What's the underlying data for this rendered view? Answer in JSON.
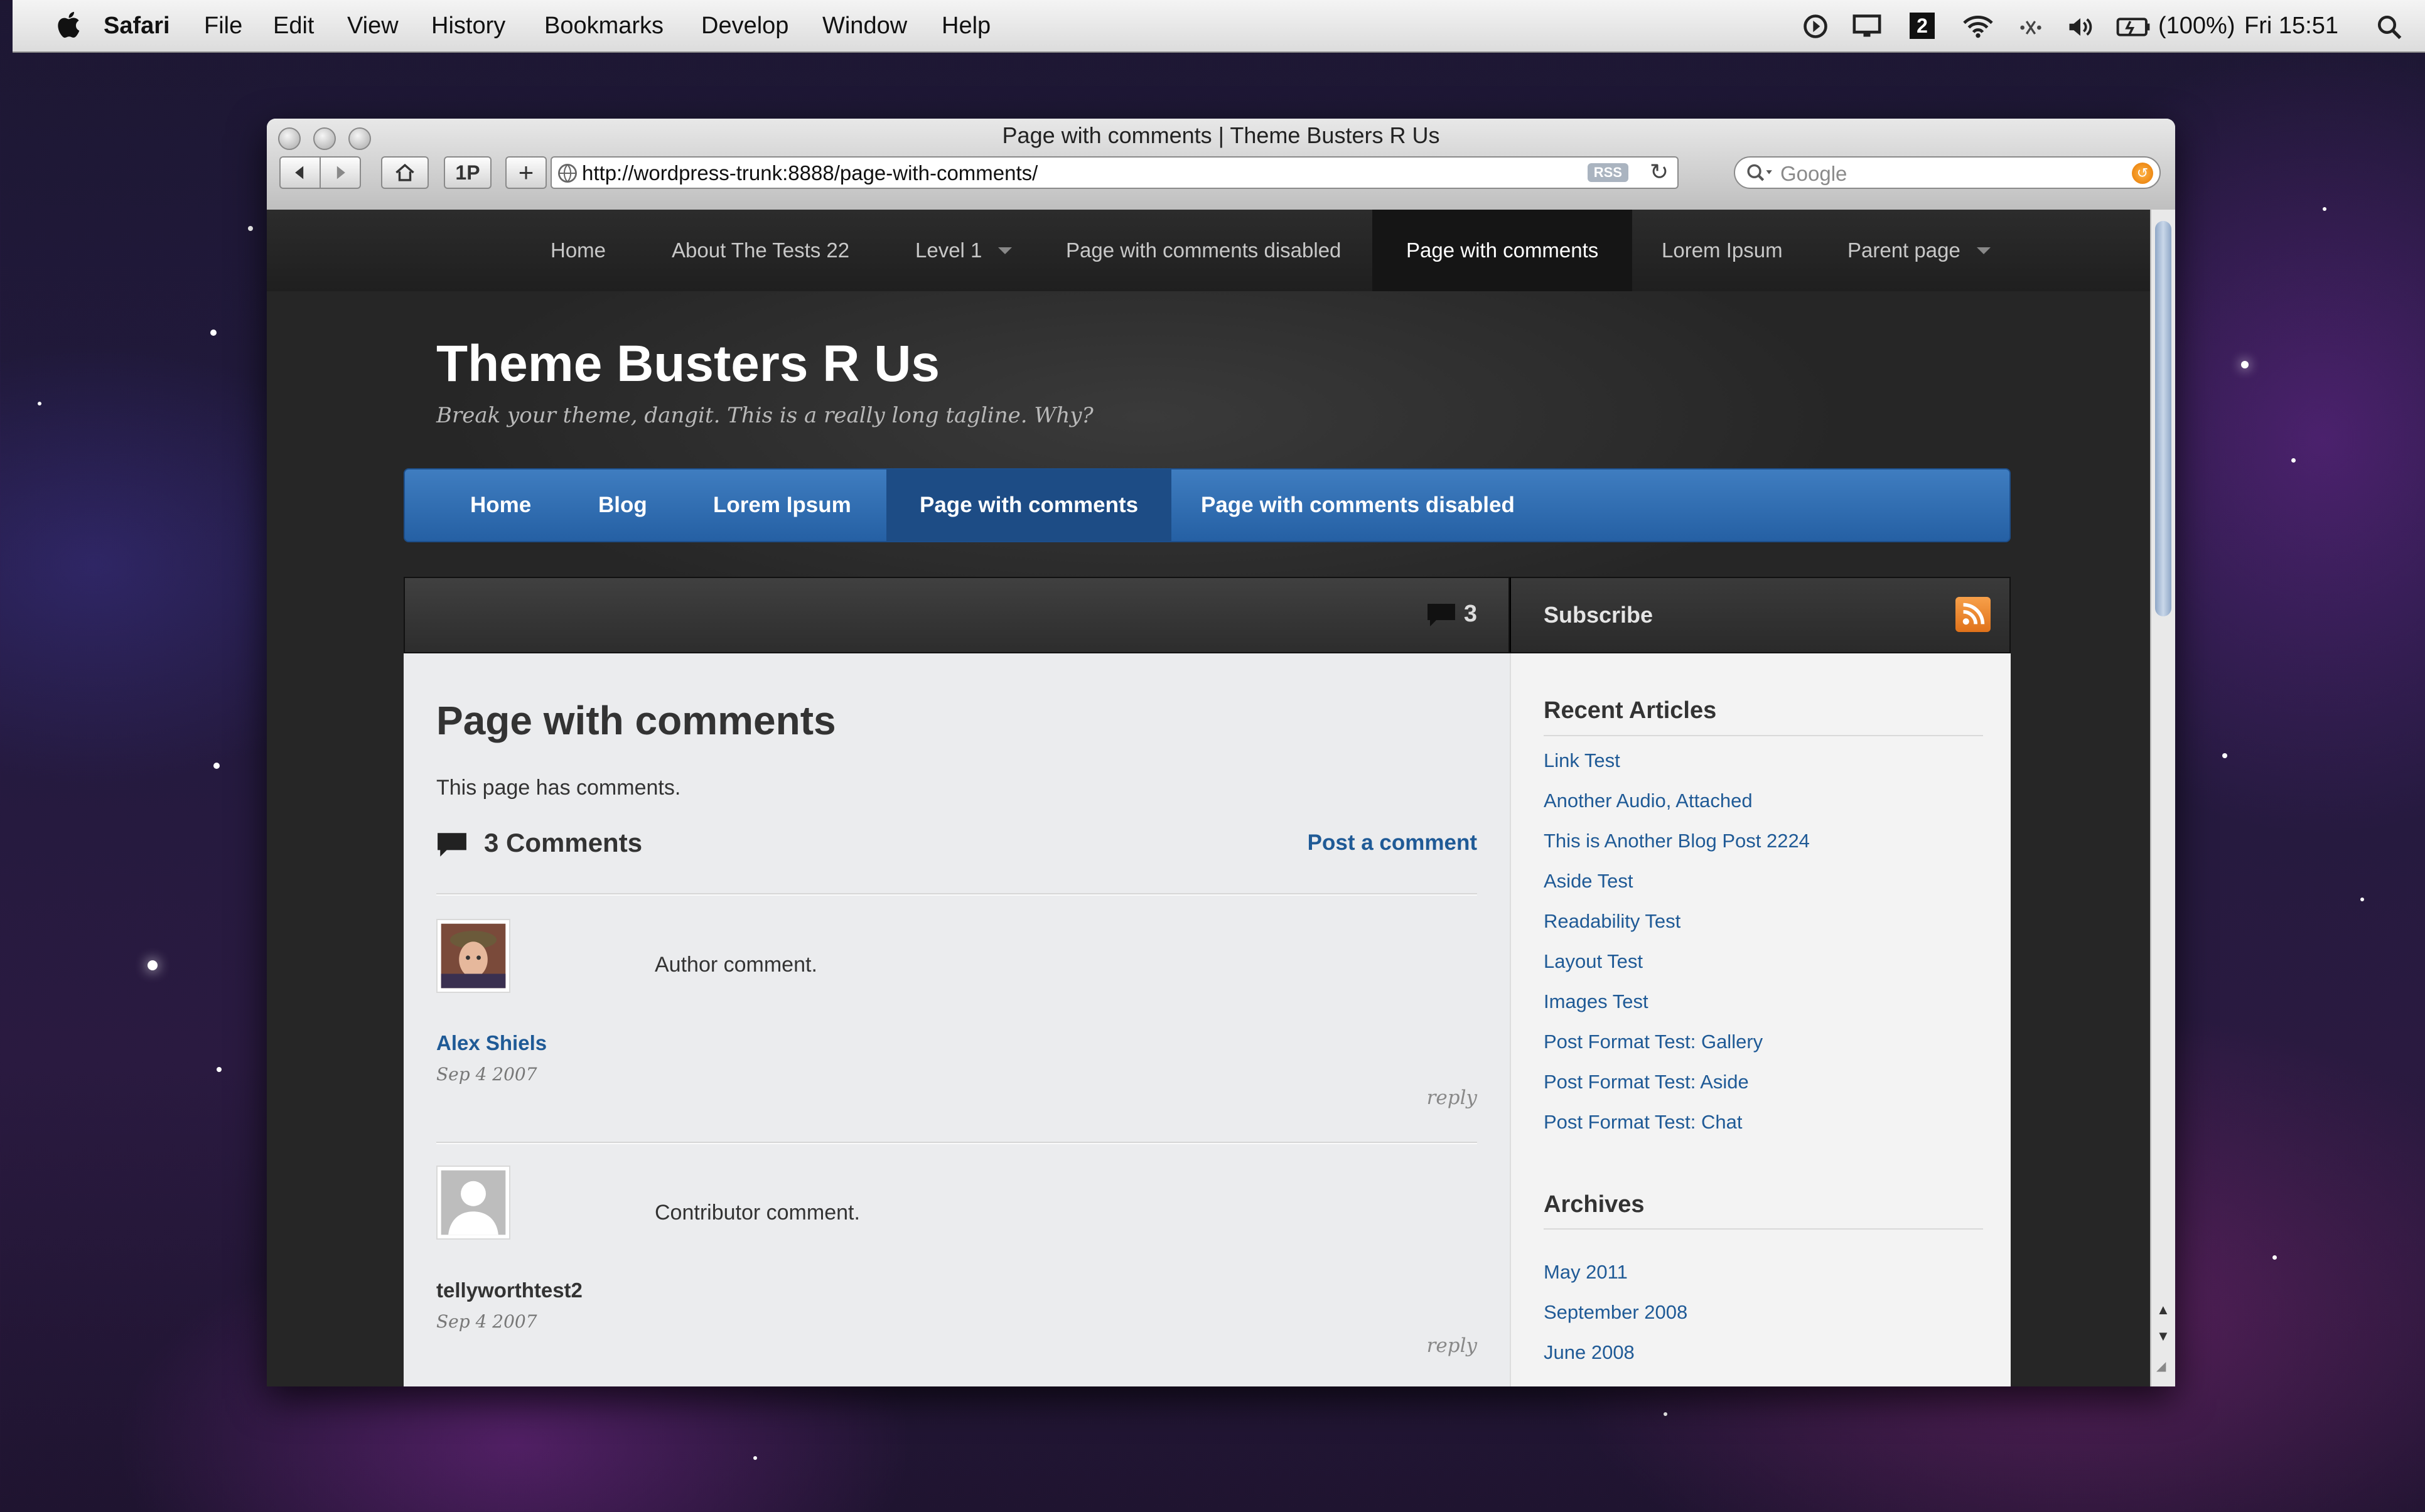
{
  "menubar": {
    "app": "Safari",
    "menus": [
      "File",
      "Edit",
      "View",
      "History",
      "Bookmarks",
      "Develop",
      "Window",
      "Help"
    ],
    "battery": "(100%)",
    "clock": "Fri 15:51",
    "status_icons": [
      "screen-recording-icon",
      "display-icon",
      "spaces-icon",
      "wifi-icon",
      "bluetooth-icon",
      "volume-icon",
      "battery-icon",
      "spotlight-icon"
    ],
    "spaces_number": "2"
  },
  "browser": {
    "window_title": "Page with comments | Theme Busters R Us",
    "url": "http://wordpress-trunk:8888/page-with-comments/",
    "rss_label": "RSS",
    "onepassword_label": "1P",
    "add_label": "+",
    "search_placeholder": "Google"
  },
  "site": {
    "top_nav": [
      {
        "label": "Home"
      },
      {
        "label": "About The Tests 22"
      },
      {
        "label": "Level 1",
        "has_submenu": true
      },
      {
        "label": "Page with comments disabled"
      },
      {
        "label": "Page with comments",
        "active": true
      },
      {
        "label": "Lorem Ipsum"
      },
      {
        "label": "Parent page",
        "has_submenu": true
      }
    ],
    "title": "Theme Busters R Us",
    "tagline": "Break your theme, dangit. This is a really long tagline. Why?",
    "main_nav": [
      {
        "label": "Home"
      },
      {
        "label": "Blog"
      },
      {
        "label": "Lorem Ipsum"
      },
      {
        "label": "Page with comments",
        "active": true
      },
      {
        "label": "Page with comments disabled"
      }
    ],
    "comment_count": "3",
    "subscribe_label": "Subscribe",
    "accent_color": "#2f6cb0"
  },
  "page": {
    "title": "Page with comments",
    "intro": "This page has comments.",
    "comments_heading": "3 Comments",
    "post_comment_label": "Post a comment",
    "comments": [
      {
        "author": "Alex Shiels",
        "date": "Sep 4 2007",
        "text": "Author comment.",
        "reply": "reply",
        "author_link": true
      },
      {
        "author": "tellyworthtest2",
        "date": "Sep 4 2007",
        "text": "Contributor comment.",
        "reply": "reply",
        "author_link": false
      }
    ]
  },
  "sidebar": {
    "recent_heading": "Recent Articles",
    "recent": [
      "Link Test",
      "Another Audio, Attached",
      "This is Another Blog Post 2224",
      "Aside Test",
      "Readability Test",
      "Layout Test",
      "Images Test",
      "Post Format Test: Gallery",
      "Post Format Test: Aside",
      "Post Format Test: Chat"
    ],
    "archives_heading": "Archives",
    "archives": [
      "May 2011",
      "September 2008",
      "June 2008"
    ]
  }
}
